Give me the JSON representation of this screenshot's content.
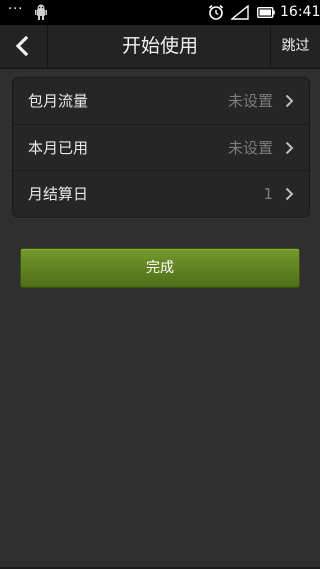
{
  "status_bar": {
    "overflow_dots": "···",
    "time": "16:41"
  },
  "header": {
    "title": "开始使用",
    "skip_label": "跳过"
  },
  "settings": {
    "rows": [
      {
        "label": "包月流量",
        "value": "未设置"
      },
      {
        "label": "本月已用",
        "value": "未设置"
      },
      {
        "label": "月结算日",
        "value": "1"
      }
    ]
  },
  "actions": {
    "done_label": "完成"
  },
  "colors": {
    "accent_green": "#5f8421",
    "background": "#2f2f30",
    "value_gray": "#7c7c7c"
  }
}
